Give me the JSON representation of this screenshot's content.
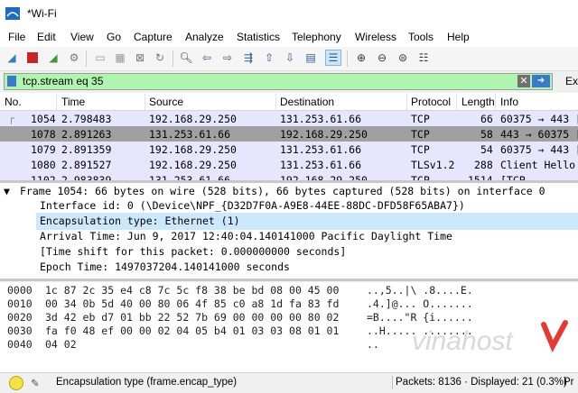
{
  "window": {
    "title": "*Wi-Fi"
  },
  "menu": [
    "File",
    "Edit",
    "View",
    "Go",
    "Capture",
    "Analyze",
    "Statistics",
    "Telephony",
    "Wireless",
    "Tools",
    "Help"
  ],
  "toolbar_icons": [
    "shark-fin-start-icon",
    "stop-icon",
    "restart-icon",
    "options-icon",
    "open-icon",
    "save-icon",
    "close-file-icon",
    "reload-icon",
    "find-icon",
    "back-icon",
    "forward-icon",
    "go-to-packet-icon",
    "first-packet-icon",
    "last-packet-icon",
    "autoscroll-icon",
    "colorize-icon",
    "zoom-in-icon",
    "zoom-out-icon",
    "normal-size-icon",
    "resize-columns-icon"
  ],
  "filter": {
    "value": "tcp.stream eq 35",
    "trailing": "Ex"
  },
  "packet_list": {
    "columns": [
      "No.",
      "Time",
      "Source",
      "Destination",
      "Protocol",
      "Length",
      "Info"
    ],
    "rows": [
      {
        "no": "1054",
        "time": "2.798483",
        "src": "192.168.29.250",
        "dst": "131.253.61.66",
        "proto": "TCP",
        "len": "66",
        "info": "60375 → 443 ["
      },
      {
        "no": "1078",
        "time": "2.891263",
        "src": "131.253.61.66",
        "dst": "192.168.29.250",
        "proto": "TCP",
        "len": "58",
        "info": "443 → 60375 ["
      },
      {
        "no": "1079",
        "time": "2.891359",
        "src": "192.168.29.250",
        "dst": "131.253.61.66",
        "proto": "TCP",
        "len": "54",
        "info": "60375 → 443 ["
      },
      {
        "no": "1080",
        "time": "2.891527",
        "src": "192.168.29.250",
        "dst": "131.253.61.66",
        "proto": "TLSv1.2",
        "len": "288",
        "info": "Client Hello"
      },
      {
        "no": "1102",
        "time": "2.983839",
        "src": "131.253.61.66",
        "dst": "192.168.29.250",
        "proto": "TCP",
        "len": "1514",
        "info": "[TCP"
      }
    ]
  },
  "details": {
    "frame": "Frame 1054: 66 bytes on wire (528 bits), 66 bytes captured (528 bits) on interface 0",
    "lines": [
      "Interface id: 0 (\\Device\\NPF_{D32D7F0A-A9E8-44EE-88DC-DFD58F65ABA7})",
      "Encapsulation type: Ethernet (1)",
      "Arrival Time: Jun  9, 2017 12:40:04.140141000 Pacific Daylight Time",
      "[Time shift for this packet: 0.000000000 seconds]",
      "Epoch Time: 1497037204.140141000 seconds"
    ]
  },
  "bytes": [
    {
      "off": "0000",
      "hex": "1c 87 2c 35 e4 c8 7c 5c  f8 38 be bd 08 00 45 00",
      "ascii": "..,5..|\\ .8....E."
    },
    {
      "off": "0010",
      "hex": "00 34 0b 5d 40 00 80 06  4f 85 c0 a8 1d fa 83 fd",
      "ascii": ".4.]@... O......."
    },
    {
      "off": "0020",
      "hex": "3d 42 eb d7 01 bb 22 52  7b 69 00 00 00 00 80 02",
      "ascii": "=B....\"R {i......"
    },
    {
      "off": "0030",
      "hex": "fa f0 48 ef 00 00 02 04  05 b4 01 03 03 08 01 01",
      "ascii": "..H..... ........"
    },
    {
      "off": "0040",
      "hex": "04 02",
      "ascii": ".."
    }
  ],
  "status": {
    "field": "Encapsulation type (frame.encap_type)",
    "packets": "Packets: 8136 · Displayed: 21 (0.3%)",
    "profile": "Pr"
  },
  "watermark": {
    "text": "vinahost"
  }
}
